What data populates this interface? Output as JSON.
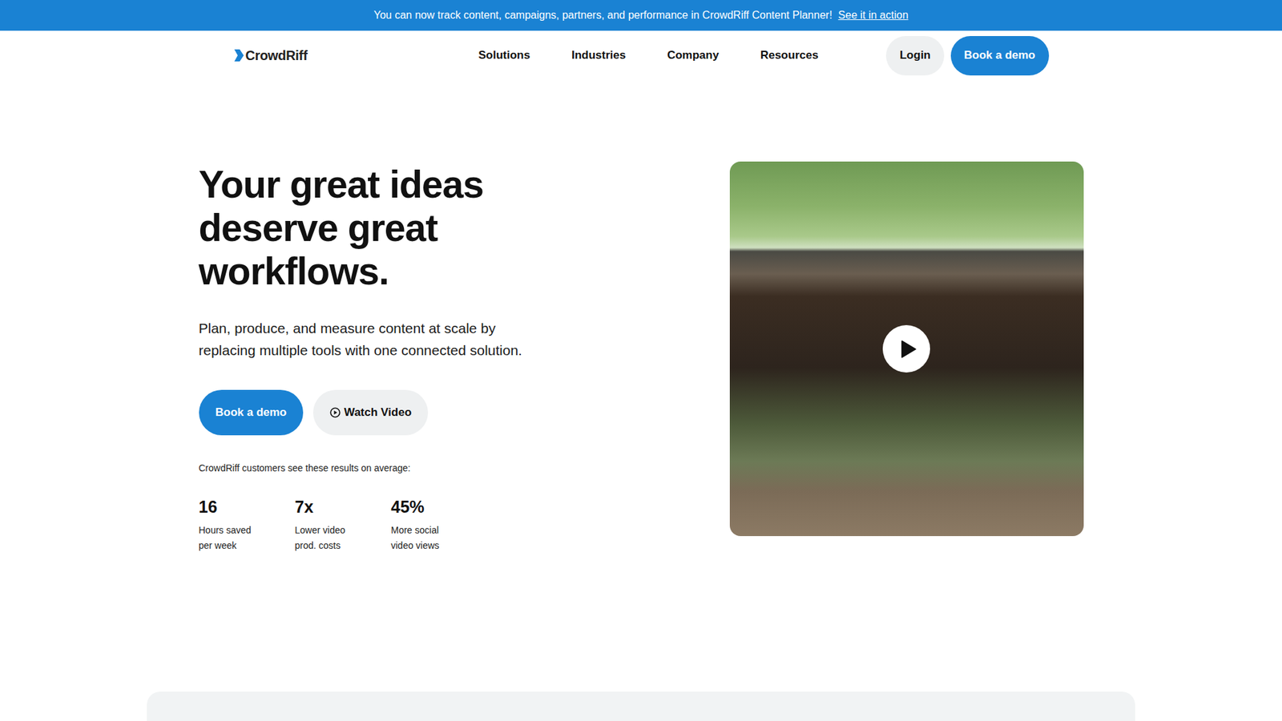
{
  "banner": {
    "text": "You can now track content, campaigns, partners, and performance in CrowdRiff Content Planner!",
    "link": "See it in action"
  },
  "logo": {
    "text": "CrowdRiff"
  },
  "nav": {
    "items": [
      "Solutions",
      "Industries",
      "Company",
      "Resources"
    ],
    "login": "Login",
    "cta": "Book a demo"
  },
  "hero": {
    "headline": [
      "Your great ideas",
      "deserve great",
      "workflows."
    ],
    "subtitle": [
      "Plan, produce, and measure content at scale by",
      "replacing multiple tools with one connected solution."
    ],
    "primary_button": "Book a demo",
    "secondary_button": "Watch Video",
    "results_caption": "CrowdRiff customers see these results on average:",
    "stats": [
      {
        "value": "16",
        "label": [
          "Hours saved",
          "per week"
        ]
      },
      {
        "value": "7x",
        "label": [
          "Lower video",
          "prod. costs"
        ]
      },
      {
        "value": "45%",
        "label": [
          "More social",
          "video views"
        ]
      }
    ]
  },
  "video": {
    "playing": false
  }
}
